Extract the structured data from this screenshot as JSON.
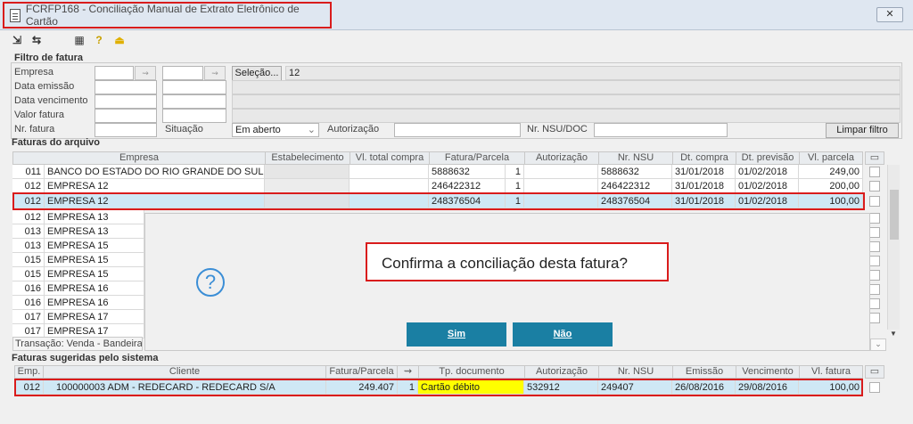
{
  "window": {
    "title": "FCRFP168 - Conciliação Manual de Extrato Eletrônico de Cartão",
    "close_label": "✕"
  },
  "filtro": {
    "title": "Filtro de fatura",
    "empresa_label": "Empresa",
    "data_emissao_label": "Data emissão",
    "data_vencimento_label": "Data vencimento",
    "valor_fatura_label": "Valor fatura",
    "nr_fatura_label": "Nr. fatura",
    "selecao_label": "Seleção...",
    "selecao_value": "12",
    "situacao_label": "Situação",
    "situacao_value": "Em aberto",
    "autorizacao_label": "Autorização",
    "nsu_label": "Nr. NSU/DOC",
    "limpar_label": "Limpar filtro"
  },
  "faturas_arquivo": {
    "title": "Faturas do arquivo",
    "columns": [
      "Empresa",
      "Estabelecimento",
      "Vl. total compra",
      "Fatura/Parcela",
      "Autorização",
      "Nr. NSU",
      "Dt. compra",
      "Dt. previsão",
      "Vl. parcela"
    ],
    "rows": [
      {
        "cod": "011",
        "empresa": "BANCO DO ESTADO DO RIO GRANDE DO SUL S/A",
        "fatura": "5888632",
        "parcela": "1",
        "nsu": "5888632",
        "dt_compra": "31/01/2018",
        "dt_previsao": "01/02/2018",
        "vl_parcela": "249,00"
      },
      {
        "cod": "012",
        "empresa": "EMPRESA 12",
        "fatura": "246422312",
        "parcela": "1",
        "nsu": "246422312",
        "dt_compra": "31/01/2018",
        "dt_previsao": "01/02/2018",
        "vl_parcela": "200,00"
      },
      {
        "cod": "012",
        "empresa": "EMPRESA 12",
        "fatura": "248376504",
        "parcela": "1",
        "nsu": "248376504",
        "dt_compra": "31/01/2018",
        "dt_previsao": "01/02/2018",
        "vl_parcela": "100,00"
      },
      {
        "cod": "012",
        "empresa": "EMPRESA 13"
      },
      {
        "cod": "013",
        "empresa": "EMPRESA 13"
      },
      {
        "cod": "013",
        "empresa": "EMPRESA 15"
      },
      {
        "cod": "015",
        "empresa": "EMPRESA 15"
      },
      {
        "cod": "015",
        "empresa": "EMPRESA 15"
      },
      {
        "cod": "016",
        "empresa": "EMPRESA 16"
      },
      {
        "cod": "016",
        "empresa": "EMPRESA 16"
      },
      {
        "cod": "017",
        "empresa": "EMPRESA 17"
      },
      {
        "cod": "017",
        "empresa": "EMPRESA 17"
      }
    ],
    "transacao": "Transação: Venda - Bandeira"
  },
  "dialog": {
    "message": "Confirma a conciliação desta fatura?",
    "sim": "Sim",
    "nao": "Não",
    "icon": "question-icon"
  },
  "faturas_sugeridas": {
    "title": "Faturas sugeridas pelo sistema",
    "columns": [
      "Emp.",
      "Cliente",
      "Fatura/Parcela",
      "Tp. documento",
      "Autorização",
      "Nr. NSU",
      "Emissão",
      "Vencimento",
      "Vl. fatura"
    ],
    "rows": [
      {
        "emp": "012",
        "cliente": "100000003 ADM - REDECARD - REDECARD S/A",
        "fatura": "249.407",
        "parcela": "1",
        "tp_doc": "Cartão débito",
        "autorizacao": "532912",
        "nsu": "249407",
        "emissao": "26/08/2016",
        "vencimento": "29/08/2016",
        "vl_fatura": "100,00"
      }
    ]
  },
  "colors": {
    "dialog_button": "#1a7fa3",
    "highlight": "#d91c1c",
    "selected_row": "#cfe8f5",
    "tp_doc_bg": "#ffff00"
  }
}
